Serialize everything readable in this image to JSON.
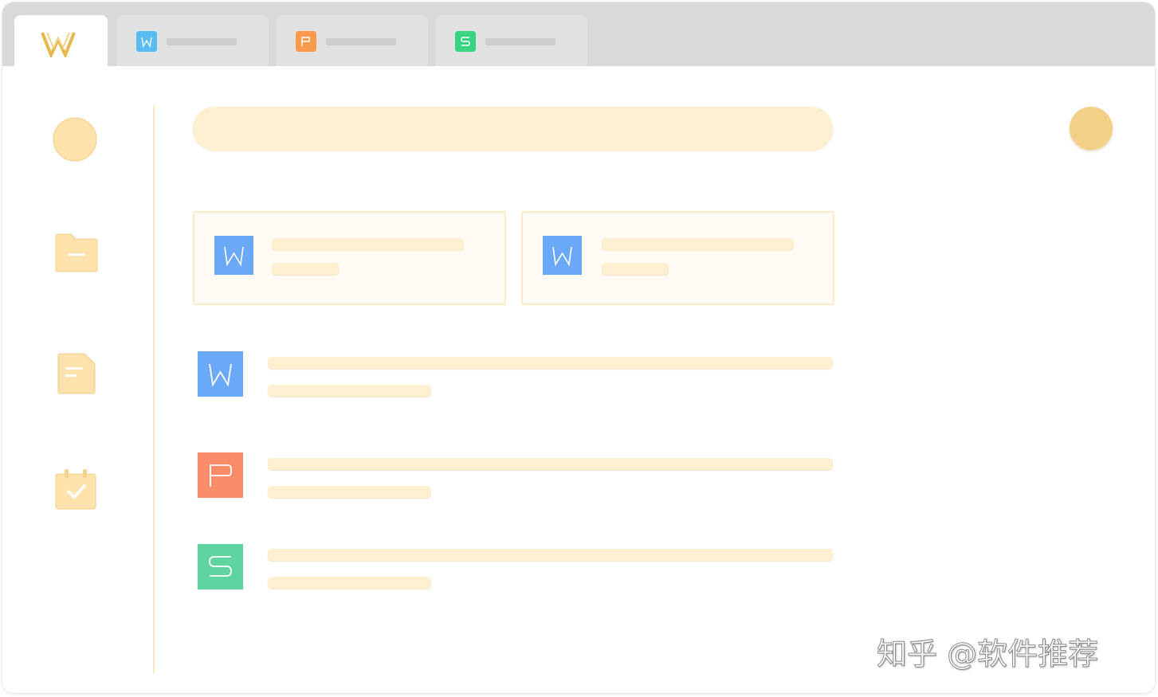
{
  "tabs": [
    {
      "name": "wps-home",
      "letter": "",
      "color": ""
    },
    {
      "name": "writer",
      "letter": "W",
      "color": "#5bbbf3"
    },
    {
      "name": "presentation",
      "letter": "P",
      "color": "#f99a4d"
    },
    {
      "name": "spreadsheet",
      "letter": "S",
      "color": "#39d384"
    }
  ],
  "colors": {
    "accent": "#f3cf88",
    "placeholder": "#fdefd0",
    "writer": "#6aa9f7",
    "presentation": "#fb8c6a",
    "spreadsheet": "#5fd3a2",
    "logo": "#e7b94c"
  },
  "sidebar": {
    "items": [
      {
        "icon": "user-circle-icon"
      },
      {
        "icon": "folder-icon"
      },
      {
        "icon": "document-icon"
      },
      {
        "icon": "calendar-check-icon"
      }
    ]
  },
  "recent_cards": [
    {
      "type": "writer",
      "letter": "W"
    },
    {
      "type": "writer",
      "letter": "W"
    }
  ],
  "file_list": [
    {
      "type": "writer",
      "letter": "W"
    },
    {
      "type": "presentation",
      "letter": "P"
    },
    {
      "type": "spreadsheet",
      "letter": "S"
    }
  ],
  "watermark": "知乎 @软件推荐"
}
